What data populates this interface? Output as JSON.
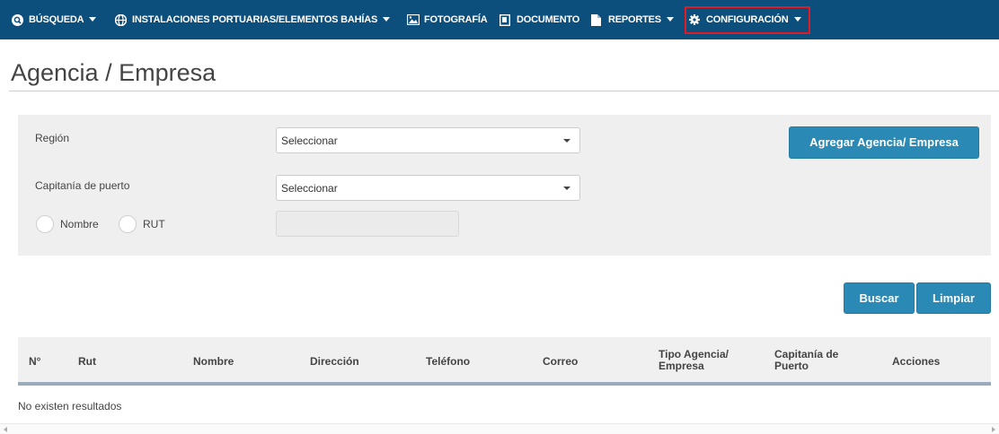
{
  "nav": {
    "items": [
      {
        "label": "BÚSQUEDA",
        "icon": "search-icon"
      },
      {
        "label": "INSTALACIONES PORTUARIAS/ELEMENTOS BAHÍAS",
        "icon": "globe-icon"
      },
      {
        "label": "FOTOGRAFÍA",
        "icon": "image-icon"
      },
      {
        "label": "DOCUMENTO",
        "icon": "document-icon"
      },
      {
        "label": "REPORTES",
        "icon": "file-icon"
      },
      {
        "label": "CONFIGURACIÓN",
        "icon": "gear-icon"
      }
    ],
    "highlight_color": "#e01b24"
  },
  "page": {
    "title": "Agencia / Empresa"
  },
  "filters": {
    "region_label": "Región",
    "region_value": "Seleccionar",
    "capitania_label": "Capitanía de puerto",
    "capitania_value": "Seleccionar",
    "radio_nombre": "Nombre",
    "radio_rut": "RUT",
    "add_button": "Agregar Agencia/ Empresa"
  },
  "actions": {
    "search": "Buscar",
    "clear": "Limpiar"
  },
  "table": {
    "headers": {
      "num": "N°",
      "rut": "Rut",
      "nombre": "Nombre",
      "direccion": "Dirección",
      "telefono": "Teléfono",
      "correo": "Correo",
      "tipo_1": "Tipo Agencia/",
      "tipo_2": "Empresa",
      "capitania_1": "Capitanía de",
      "capitania_2": "Puerto",
      "acciones": "Acciones"
    },
    "empty_message": "No existen resultados"
  },
  "colors": {
    "nav_bg": "#0d4f7c",
    "button": "#2b8ab5",
    "panel": "#efefef"
  }
}
